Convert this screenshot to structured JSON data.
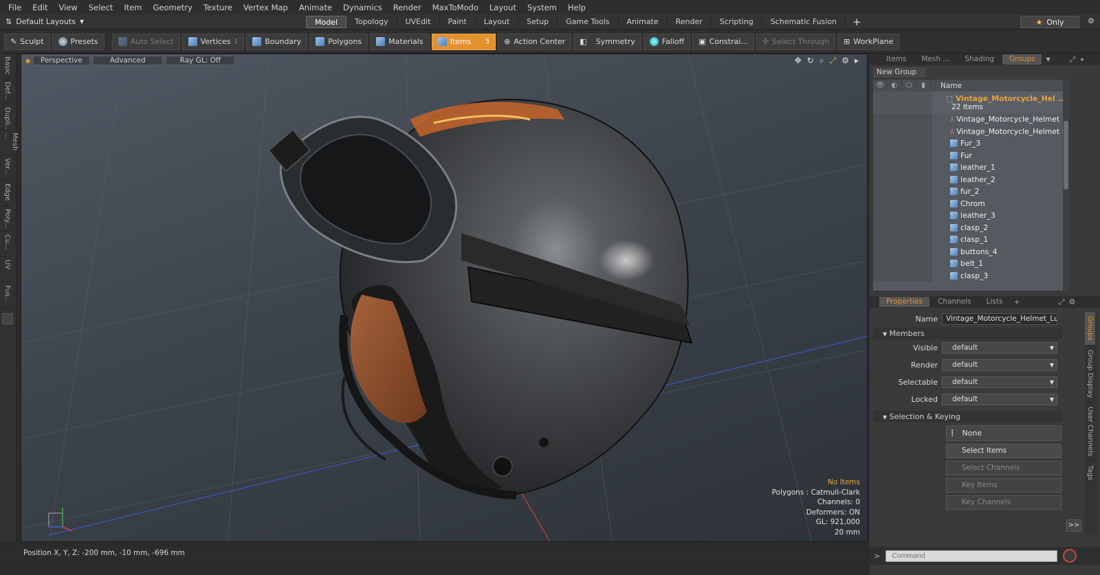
{
  "menu": [
    "File",
    "Edit",
    "View",
    "Select",
    "Item",
    "Geometry",
    "Texture",
    "Vertex Map",
    "Animate",
    "Dynamics",
    "Render",
    "MaxToModo",
    "Layout",
    "System",
    "Help"
  ],
  "layout": {
    "label": "Default Layouts"
  },
  "modeTabs": [
    "Model",
    "Topology",
    "UVEdit",
    "Paint",
    "Layout",
    "Setup",
    "Game Tools",
    "Animate",
    "Render",
    "Scripting",
    "Schematic Fusion"
  ],
  "only": "Only",
  "tools": {
    "sculpt": "Sculpt",
    "presets": "Presets",
    "autoSelect": "Auto Select",
    "vertices": "Vertices",
    "verticesCount": "1",
    "boundary": "Boundary",
    "polygons": "Polygons",
    "materials": "Materials",
    "items": "Items",
    "itemsCount": "5",
    "actionCenter": "Action Center",
    "symmetry": "Symmetry",
    "falloff": "Falloff",
    "constrain": "Constrai...",
    "selectThrough": "Select Through",
    "workplane": "WorkPlane"
  },
  "leftTabs": [
    "Basic",
    "Def...",
    "Dupli...",
    "Mesh ...",
    "Ver...",
    "Edge",
    "Poly...",
    "Cu...",
    "UV",
    "Fus..."
  ],
  "viewport": {
    "perspective": "Perspective",
    "advanced": "Advanced",
    "raygl": "Ray GL: Off"
  },
  "stats": {
    "noItems": "No Items",
    "polygons": "Polygons : Catmull-Clark",
    "channels": "Channels: 0",
    "deformers": "Deformers: ON",
    "gl": "GL: 921,000",
    "scale": "20 mm"
  },
  "status": {
    "position": "Position X, Y, Z:  -200 mm, -10 mm, -696 mm"
  },
  "panelTabs": [
    "Items",
    "Mesh ...",
    "Shading",
    "Groups"
  ],
  "newGroup": "New Group",
  "tree": {
    "nameHeader": "Name",
    "group": "Vintage_Motorcycle_Hel ...",
    "groupCount": "22 Items",
    "items": [
      "Vintage_Motorcycle_Helmet ...",
      "Vintage_Motorcycle_Helmet ...",
      "Fur_3",
      "Fur",
      "leather_1",
      "leather_2",
      "fur_2",
      "Chrom",
      "leather_3",
      "clasp_2",
      "clasp_1",
      "buttons_4",
      "belt_1",
      "clasp_3"
    ]
  },
  "propTabs": [
    "Properties",
    "Channels",
    "Lists"
  ],
  "props": {
    "nameLabel": "Name",
    "nameValue": "Vintage_Motorcycle_Helmet_Luck",
    "members": "Members",
    "visibleLabel": "Visible",
    "visible": "default",
    "renderLabel": "Render",
    "render": "default",
    "selectableLabel": "Selectable",
    "selectable": "default",
    "lockedLabel": "Locked",
    "locked": "default",
    "selKeying": "Selection & Keying",
    "none": "None",
    "selectItems": "Select Items",
    "selectChannels": "Select Channels",
    "keyItems": "Key Items",
    "keyChannels": "Key Channels"
  },
  "sideTabs": [
    "Groups",
    "Group Display",
    "User Channels",
    "Tags"
  ],
  "command": {
    "placeholder": "Command"
  }
}
